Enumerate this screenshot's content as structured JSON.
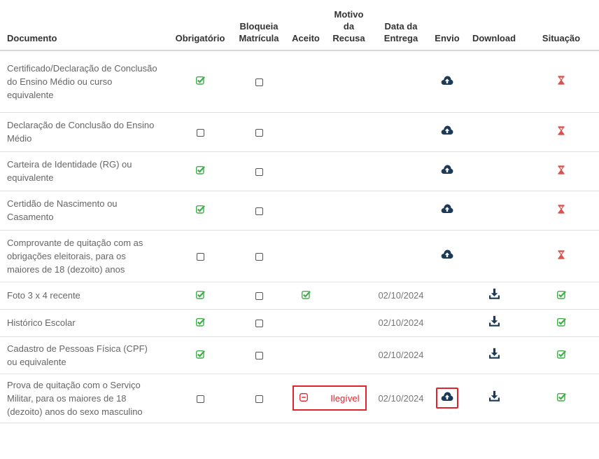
{
  "columns": {
    "documento": "Documento",
    "obrigatorio": "Obrigatório",
    "bloqueia": [
      "Bloqueia",
      "Matrícula"
    ],
    "aceito": "Aceito",
    "motivo": [
      "Motivo",
      "da",
      "Recusa"
    ],
    "data": [
      "Data da",
      "Entrega"
    ],
    "envio": "Envio",
    "download": "Download",
    "situacao": "Situação"
  },
  "colors": {
    "check": "#3fae49",
    "upload": "#1b3a57",
    "pending": "#d9534f",
    "highlight": "#e0242d"
  },
  "rows": [
    {
      "documento": "Certificado/Declaração de Conclusão do Ensino Médio ou curso equivalente",
      "obrigatorio": true,
      "bloqueia": false,
      "aceito": false,
      "motivo": "",
      "data": "",
      "envio": true,
      "download": false,
      "situacao": "pending"
    },
    {
      "documento": "Declaração de Conclusão do Ensino Médio",
      "obrigatorio": false,
      "bloqueia": false,
      "aceito": false,
      "motivo": "",
      "data": "",
      "envio": true,
      "download": false,
      "situacao": "pending"
    },
    {
      "documento": "Carteira de Identidade (RG) ou equivalente",
      "obrigatorio": true,
      "bloqueia": false,
      "aceito": false,
      "motivo": "",
      "data": "",
      "envio": true,
      "download": false,
      "situacao": "pending"
    },
    {
      "documento": "Certidão de Nascimento ou Casamento",
      "obrigatorio": true,
      "bloqueia": false,
      "aceito": false,
      "motivo": "",
      "data": "",
      "envio": true,
      "download": false,
      "situacao": "pending"
    },
    {
      "documento": "Comprovante de quitação com as obrigações eleitorais, para os maiores de 18 (dezoito) anos",
      "obrigatorio": false,
      "bloqueia": false,
      "aceito": false,
      "motivo": "",
      "data": "",
      "envio": true,
      "download": false,
      "situacao": "pending"
    },
    {
      "documento": "Foto 3 x 4 recente",
      "obrigatorio": true,
      "bloqueia": false,
      "aceito": true,
      "motivo": "",
      "data": "02/10/2024",
      "envio": false,
      "download": true,
      "situacao": "ok"
    },
    {
      "documento": "Histórico Escolar",
      "obrigatorio": true,
      "bloqueia": false,
      "aceito": false,
      "motivo": "",
      "data": "02/10/2024",
      "envio": false,
      "download": true,
      "situacao": "ok"
    },
    {
      "documento": "Cadastro de Pessoas Física (CPF) ou equivalente",
      "obrigatorio": true,
      "bloqueia": false,
      "aceito": false,
      "motivo": "",
      "data": "02/10/2024",
      "envio": false,
      "download": true,
      "situacao": "ok"
    },
    {
      "documento": "Prova de quitação com o Serviço Militar, para os maiores de 18 (dezoito) anos do sexo masculino",
      "obrigatorio": false,
      "bloqueia": false,
      "aceito": "refused",
      "motivo": "Ilegível",
      "data": "02/10/2024",
      "envio": true,
      "download": true,
      "situacao": "ok",
      "highlight": true
    }
  ]
}
